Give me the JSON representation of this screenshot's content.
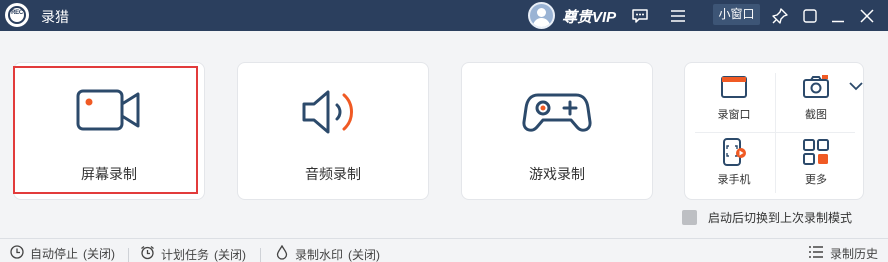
{
  "titlebar": {
    "logo_text": "REC",
    "app_title": "录猎",
    "vip_label": "尊贵VIP",
    "mini_window_label": "小窗口"
  },
  "main": {
    "cards": [
      {
        "label": "屏幕录制",
        "icon": "camera-icon",
        "selected": true
      },
      {
        "label": "音频录制",
        "icon": "speaker-icon"
      },
      {
        "label": "游戏录制",
        "icon": "gamepad-icon"
      }
    ],
    "tools": [
      {
        "label": "录窗口",
        "icon": "window-record-icon"
      },
      {
        "label": "截图",
        "icon": "screenshot-icon"
      },
      {
        "label": "录手机",
        "icon": "phone-record-icon"
      },
      {
        "label": "更多",
        "icon": "more-grid-icon"
      }
    ]
  },
  "autostart": {
    "label": "启动后切换到上次录制模式",
    "checked": false
  },
  "statusbar": {
    "auto_stop": {
      "label": "自动停止",
      "value": "(关闭)"
    },
    "schedule": {
      "label": "计划任务",
      "value": "(关闭)"
    },
    "watermark": {
      "label": "录制水印",
      "value": "(关闭)"
    },
    "history": {
      "label": "录制历史"
    }
  },
  "colors": {
    "titlebar": "#2b3f5e",
    "accent_orange": "#f05a24",
    "icon_navy": "#2c4a6b",
    "selected_border": "#e23b3b"
  }
}
